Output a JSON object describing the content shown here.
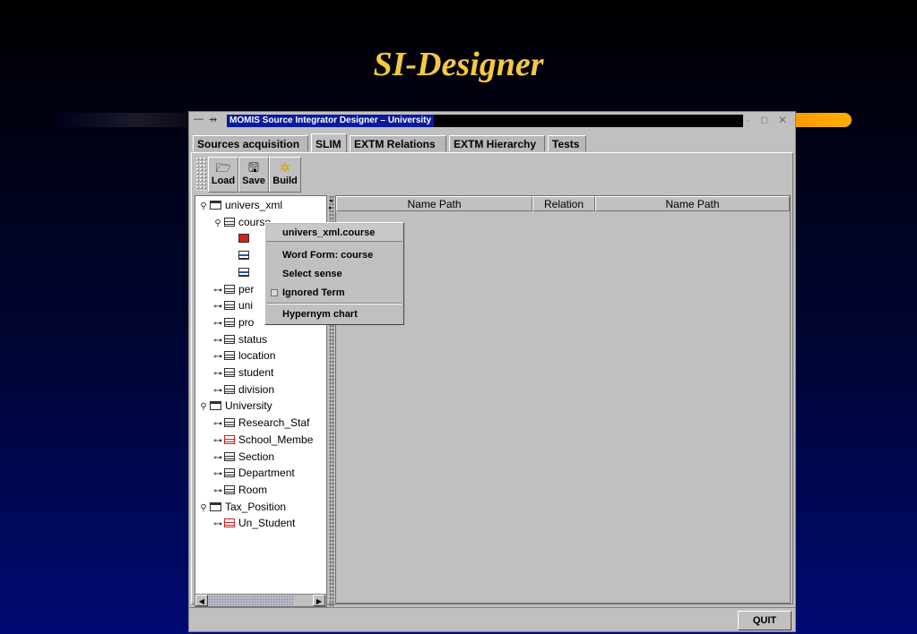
{
  "slide": {
    "title": "SI-Designer"
  },
  "window": {
    "title": "MOMIS Source Integrator Designer – University",
    "system_menu_glyph": "—",
    "pin_glyph": "⇸",
    "controls": {
      "minimize": "·",
      "maximize": "□",
      "close": "✕"
    }
  },
  "tabs": [
    {
      "label": "Sources acquisition",
      "active": false
    },
    {
      "label": "SLIM",
      "active": true
    },
    {
      "label": "EXTM Relations",
      "active": false
    },
    {
      "label": "EXTM Hierarchy",
      "active": false
    },
    {
      "label": "Tests",
      "active": false
    }
  ],
  "toolbar": {
    "load_label": "Load",
    "load_icon": "🗁",
    "save_label": "Save",
    "save_icon": "🖫",
    "build_label": "Build",
    "build_icon": "✲"
  },
  "tree": {
    "expanded_handle": "⚲",
    "collapsed_handle": "⊶",
    "nodes": [
      {
        "label": "univers_xml",
        "icon": "folder",
        "handle": "expanded",
        "level": 0
      },
      {
        "label": "course",
        "icon": "table",
        "handle": "expanded",
        "level": 1
      },
      {
        "label": "",
        "icon": "table-redfill",
        "handle": "none",
        "level": 2
      },
      {
        "label": "",
        "icon": "table-blue",
        "handle": "none",
        "level": 2
      },
      {
        "label": "",
        "icon": "table-blue",
        "handle": "none",
        "level": 2
      },
      {
        "label": "per",
        "icon": "table",
        "handle": "collapsed",
        "level": 1
      },
      {
        "label": "uni",
        "icon": "table",
        "handle": "collapsed",
        "level": 1
      },
      {
        "label": "pro",
        "icon": "table",
        "handle": "collapsed",
        "level": 1
      },
      {
        "label": "status",
        "icon": "table",
        "handle": "collapsed",
        "level": 1
      },
      {
        "label": "location",
        "icon": "table",
        "handle": "collapsed",
        "level": 1
      },
      {
        "label": "student",
        "icon": "table",
        "handle": "collapsed",
        "level": 1
      },
      {
        "label": "division",
        "icon": "table",
        "handle": "collapsed",
        "level": 1
      },
      {
        "label": "University",
        "icon": "folder",
        "handle": "expanded",
        "level": 0
      },
      {
        "label": "Research_Staf",
        "icon": "table",
        "handle": "collapsed",
        "level": 1
      },
      {
        "label": "School_Membe",
        "icon": "table-red",
        "handle": "collapsed",
        "level": 1
      },
      {
        "label": "Section",
        "icon": "table",
        "handle": "collapsed",
        "level": 1
      },
      {
        "label": "Department",
        "icon": "table",
        "handle": "collapsed",
        "level": 1
      },
      {
        "label": "Room",
        "icon": "table",
        "handle": "collapsed",
        "level": 1
      },
      {
        "label": "Tax_Position",
        "icon": "folder",
        "handle": "expanded",
        "level": 0
      },
      {
        "label": "Un_Student",
        "icon": "table-red",
        "handle": "collapsed",
        "level": 1
      }
    ]
  },
  "scrollbar": {
    "left_arrow": "◀",
    "right_arrow": "▶"
  },
  "splitter": {
    "left_arrow": "◂",
    "right_arrow": "▸"
  },
  "table": {
    "columns": [
      "Name Path",
      "Relation",
      "Name Path"
    ]
  },
  "context_menu": {
    "header": "univers_xml.course",
    "word_form": "Word Form: course",
    "select_sense": "Select sense",
    "ignored_term": "Ignored Term",
    "hypernym_chart": "Hypernym chart"
  },
  "quit_label": "QUIT"
}
